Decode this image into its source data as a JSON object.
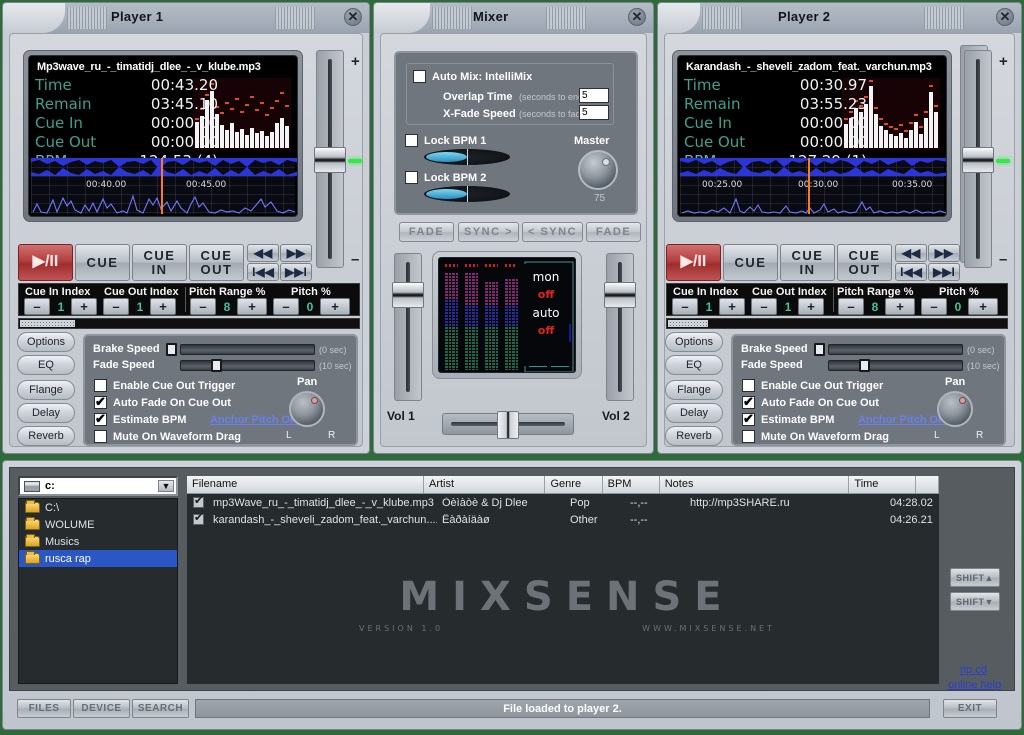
{
  "players": [
    {
      "title": "Player 1",
      "track": "Mp3wave_ru_-_timatidj_dlee_-_v_klube.mp3",
      "fields": [
        {
          "label": "Time",
          "value": "00:43.20"
        },
        {
          "label": "Remain",
          "value": "03:45.10"
        },
        {
          "label": "Cue In",
          "value": "00:00.00"
        },
        {
          "label": "Cue Out",
          "value": "00:00.00"
        },
        {
          "label": "BPM",
          "value": "124,53 (4)"
        }
      ],
      "wave_times": [
        "00:40.00",
        "00:45.00"
      ],
      "transport": {
        "play": "▶/II",
        "cue": "CUE",
        "cue_in": "CUE IN",
        "cue_out": "CUE OUT",
        "rew": "◀◀",
        "ffwd": "▶▶",
        "prev": "I◀◀",
        "next": "▶▶I"
      },
      "strip": {
        "cue_in_index_label": "Cue In Index",
        "cue_in_index_value": "1",
        "cue_out_index_label": "Cue Out Index",
        "cue_out_index_value": "1",
        "pitch_range_label": "Pitch Range %",
        "pitch_range_value": "8",
        "pitch_label": "Pitch %",
        "pitch_value": "0",
        "minus": "–",
        "plus": "+"
      },
      "pills": [
        "Options",
        "EQ",
        "Flange",
        "Delay",
        "Reverb"
      ],
      "options": {
        "brake_speed_label": "Brake Speed",
        "brake_speed_hint": "(0 sec)",
        "fade_speed_label": "Fade Speed",
        "fade_speed_hint": "(10 sec)",
        "checks": [
          {
            "label": "Enable Cue Out Trigger",
            "checked": false
          },
          {
            "label": "Auto Fade On Cue Out",
            "checked": true
          },
          {
            "label": "Estimate BPM",
            "checked": true
          },
          {
            "label": "Mute On Waveform Drag",
            "checked": false
          }
        ],
        "anchor_link": "Anchor Pitch OFF",
        "pan_label": "Pan",
        "pan_left": "L",
        "pan_right": "R"
      },
      "fader": {
        "plus": "+",
        "minus": "–"
      }
    },
    {
      "title": "Player 2",
      "track": "Karandash_-_sheveli_zadom_feat._varchun.mp3",
      "fields": [
        {
          "label": "Time",
          "value": "00:30.97"
        },
        {
          "label": "Remain",
          "value": "03:55.23"
        },
        {
          "label": "Cue In",
          "value": "00:00.00"
        },
        {
          "label": "Cue Out",
          "value": "00:00.00"
        },
        {
          "label": "BPM",
          "value": "127,29 (1)"
        }
      ],
      "wave_times": [
        "00:25.00",
        "00:30.00",
        "00:35.00"
      ],
      "transport": {
        "play": "▶/II",
        "cue": "CUE",
        "cue_in": "CUE IN",
        "cue_out": "CUE OUT",
        "rew": "◀◀",
        "ffwd": "▶▶",
        "prev": "I◀◀",
        "next": "▶▶I"
      },
      "strip": {
        "cue_in_index_label": "Cue In Index",
        "cue_in_index_value": "1",
        "cue_out_index_label": "Cue Out Index",
        "cue_out_index_value": "1",
        "pitch_range_label": "Pitch Range %",
        "pitch_range_value": "8",
        "pitch_label": "Pitch %",
        "pitch_value": "0",
        "minus": "–",
        "plus": "+"
      },
      "pills": [
        "Options",
        "EQ",
        "Flange",
        "Delay",
        "Reverb"
      ],
      "options": {
        "brake_speed_label": "Brake Speed",
        "brake_speed_hint": "(0 sec)",
        "fade_speed_label": "Fade Speed",
        "fade_speed_hint": "(10 sec)",
        "checks": [
          {
            "label": "Enable Cue Out Trigger",
            "checked": false
          },
          {
            "label": "Auto Fade On Cue Out",
            "checked": true
          },
          {
            "label": "Estimate BPM",
            "checked": true
          },
          {
            "label": "Mute On Waveform Drag",
            "checked": false
          }
        ],
        "anchor_link": "Anchor Pitch OFF",
        "pan_label": "Pan",
        "pan_left": "L",
        "pan_right": "R"
      },
      "fader": {
        "plus": "+",
        "minus": "–"
      }
    }
  ],
  "mixer": {
    "title": "Mixer",
    "automix_label": "Auto Mix: IntelliMix",
    "automix_checked": false,
    "overlap_label": "Overlap Time",
    "overlap_hint": "(seconds to end)",
    "overlap_value": "5",
    "xfade_label": "X-Fade Speed",
    "xfade_hint": "(seconds to fade)",
    "xfade_value": "5",
    "lock_bpm_1": "Lock BPM 1",
    "lock_bpm_1_checked": false,
    "lock_bpm_2": "Lock BPM 2",
    "lock_bpm_2_checked": false,
    "master_label": "Master",
    "master_value": "75",
    "buttons": [
      "FADE",
      "SYNC >",
      "< SYNC",
      "FADE"
    ],
    "vu_texts": [
      {
        "text": "mon",
        "color": "#ffffff"
      },
      {
        "text": "off",
        "color": "#e02424"
      },
      {
        "text": "auto",
        "color": "#ffffff"
      },
      {
        "text": "off",
        "color": "#e02424"
      }
    ],
    "vol1_label": "Vol 1",
    "vol2_label": "Vol 2"
  },
  "browser": {
    "drive": "c:",
    "tree": [
      {
        "label": "C:\\",
        "selected": false
      },
      {
        "label": "WOLUME",
        "selected": false
      },
      {
        "label": "Musics",
        "selected": false
      },
      {
        "label": "rusca rap",
        "selected": true
      }
    ],
    "columns": [
      "Filename",
      "Artist",
      "Genre",
      "BPM",
      "Notes",
      "Time",
      ""
    ],
    "rows": [
      {
        "checked": true,
        "filename": "mp3Wave_ru_-_timatidj_dlee_-_v_klube.mp3",
        "artist": "Òèìàòè & Dj Dlee",
        "genre": "Pop",
        "bpm": "--,--",
        "notes": "http://mp3SHARE.ru",
        "time": "04:28.02"
      },
      {
        "checked": true,
        "filename": "karandash_-_sheveli_zadom_feat._varchun....",
        "artist": "Êàðàíäàø",
        "genre": "Other",
        "bpm": "--,--",
        "notes": "",
        "time": "04:26.21"
      }
    ],
    "logo_main": "MIXSENSE",
    "logo_version": "VERSION 1.0",
    "logo_url": "WWW.MIXSENSE.NET",
    "shift_up": "SHIFT▲",
    "shift_down": "SHIFT▼",
    "rip_cd": "rip cd",
    "online_help": "online help",
    "tab_files": "FILES",
    "tab_device": "DEVICE",
    "tab_search": "SEARCH",
    "status": "File loaded to player 2.",
    "exit": "EXIT"
  }
}
